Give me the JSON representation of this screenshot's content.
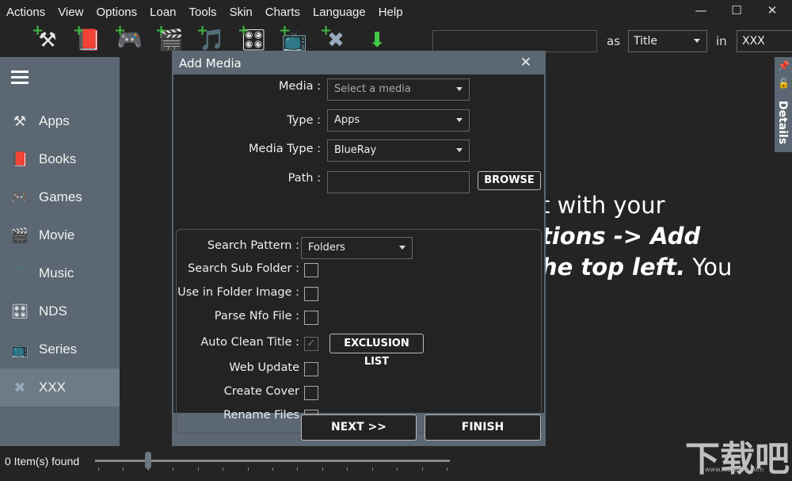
{
  "menu": [
    "Actions",
    "View",
    "Options",
    "Loan",
    "Tools",
    "Skin",
    "Charts",
    "Language",
    "Help"
  ],
  "toolbar": [
    {
      "icon": "add-apps-icon",
      "glyph": "⚒"
    },
    {
      "icon": "add-books-icon",
      "glyph": "📕"
    },
    {
      "icon": "add-games-icon",
      "glyph": "🎮"
    },
    {
      "icon": "add-movie-icon",
      "glyph": "🎬"
    },
    {
      "icon": "add-music-icon",
      "glyph": "🎵"
    },
    {
      "icon": "add-nds-icon",
      "glyph": "🎛"
    },
    {
      "icon": "add-series-icon",
      "glyph": "📺"
    },
    {
      "icon": "add-xxx-icon",
      "glyph": "✖"
    },
    {
      "icon": "download-icon",
      "glyph": "⬇"
    }
  ],
  "search": {
    "value": "",
    "as_label": "as",
    "as_value": "Title",
    "in_label": "in",
    "in_value": "XXX"
  },
  "sidebar": {
    "items": [
      {
        "label": "Apps",
        "glyph": "⚒"
      },
      {
        "label": "Books",
        "glyph": "📕"
      },
      {
        "label": "Games",
        "glyph": "🎮"
      },
      {
        "label": "Movie",
        "glyph": "🎬"
      },
      {
        "label": "Music",
        "glyph": "🎵"
      },
      {
        "label": "NDS",
        "glyph": "🎛"
      },
      {
        "label": "Series",
        "glyph": "📺"
      },
      {
        "label": "XXX",
        "glyph": "✖"
      }
    ],
    "active": "XXX"
  },
  "details_label": "Details",
  "background_text": {
    "line1": "t with your",
    "line2": "tions -> Add",
    "line3a": "he top left.",
    "line3b": " You"
  },
  "dialog": {
    "title": "Add Media",
    "media_label": "Media :",
    "media_placeholder": "Select a media",
    "type_label": "Type :",
    "type_value": "Apps",
    "media_type_label": "Media Type :",
    "media_type_value": "BlueRay",
    "path_label": "Path :",
    "path_value": "",
    "browse": "BROWSE",
    "search_pattern_label": "Search Pattern :",
    "search_pattern_value": "Folders",
    "options": [
      {
        "label": "Search Sub Folder :",
        "checked": false
      },
      {
        "label": "Use in Folder Image :",
        "checked": false
      },
      {
        "label": "Parse Nfo File :",
        "checked": false
      },
      {
        "label": "Auto Clean Title :",
        "checked": true
      },
      {
        "label": "Web Update",
        "checked": false
      },
      {
        "label": "Create Cover",
        "checked": false
      },
      {
        "label": "Rename Files",
        "checked": false
      }
    ],
    "exclusion_list": "EXCLUSION LIST",
    "next": "NEXT >>",
    "finish": "FINISH"
  },
  "status": {
    "items_found": "0 Item(s) found",
    "zoom_slider_percent": 15
  },
  "watermark": {
    "text": "下载吧",
    "url_text": "www.xiazaiba.com"
  },
  "colors": {
    "background": "#242424",
    "sidebar": "#5b6772",
    "sidebar_active": "#6e7b87"
  }
}
